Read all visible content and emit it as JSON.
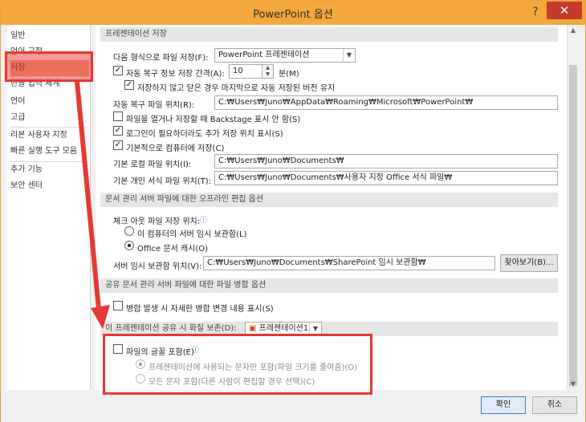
{
  "window": {
    "title": "PowerPoint 옵션",
    "help": "?",
    "close": "✕"
  },
  "sidebar": {
    "items": [
      {
        "label": "일반"
      },
      {
        "label": "언어 교정"
      },
      {
        "label": "저장"
      },
      {
        "label": "한글 입력 체계"
      },
      {
        "label": "언어"
      },
      {
        "label": "고급"
      },
      {
        "label": "리본 사용자 지정"
      },
      {
        "label": "빠른 실행 도구 모음"
      },
      {
        "label": "추가 기능"
      },
      {
        "label": "보안 센터"
      }
    ]
  },
  "save": {
    "section_title": "프레젠테이션 저장",
    "format_label": "다음 형식으로 파일 저장(F):",
    "format_value": "PowerPoint 프레젠테이션",
    "autorecover_label": "자동 복구 정보 저장 간격(A):",
    "autorecover_value": "10",
    "minutes": "분(M)",
    "keep_last_label": "저장하지 않고 닫은 경우 마지막으로 자동 저장된 버전 유지",
    "autorecover_location_label": "자동 복구 파일 위치(R):",
    "autorecover_location_value": "C:₩Users₩Juno₩AppData₩Roaming₩Microsoft₩PowerPoint₩",
    "no_backstage_label": "파일을 열거나 저장할 때 Backstage 표시 안 함(S)",
    "show_additional_label": "로그인이 필요하더라도 추가 저장 위치 표시(S)",
    "save_to_computer_label": "기본적으로 컴퓨터에 저장(C)",
    "default_local_label": "기본 로컬 파일 위치(I):",
    "default_local_value": "C:₩Users₩Juno₩Documents₩",
    "personal_templates_label": "기본 개인 서식 파일 위치(T):",
    "personal_templates_value": "C:₩Users₩Juno₩Documents₩사용자 지정 Office 서식 파일₩"
  },
  "offline": {
    "section_title": "문서 관리 서버 파일에 대한 오프라인 편집 옵션",
    "checkout_label": "체크 아웃 파일 저장 위치:",
    "option_server_drafts": "이 컴퓨터의 서버 임시 보관함(L)",
    "option_office_cache": "Office 문서 캐시(O)",
    "server_drafts_label": "서버 임시 보관함 위치(V):",
    "server_drafts_value": "C:₩Users₩Juno₩Documents₩SharePoint 임시 보관함₩",
    "browse_button": "찾아보기(B)..."
  },
  "merge": {
    "section_title": "공유 문서 관리 서버 파일에 대한 파일 병합 옵션",
    "show_details_label": "병합 발생 시 자세한 병합 변경 내용 표시(S)"
  },
  "fidelity": {
    "section_title": "이 프레젠테이션 공유 시 화질 보존(D):",
    "presentation_value": "프레젠테이션1",
    "embed_fonts_label": "파일의 글꼴 포함(E)",
    "embed_used_only_label": "프레젠테이션에 사용되는 문자만 포함(파일 크기를 줄여줌)(O)",
    "embed_all_label": "모든 문자 포함(다른 사람이 편집할 경우 선택)(C)"
  },
  "footer": {
    "ok": "확인",
    "cancel": "취소"
  },
  "colors": {
    "title_bar": "#f4a83c",
    "close": "#c7392b",
    "annotation": "#e53935"
  }
}
